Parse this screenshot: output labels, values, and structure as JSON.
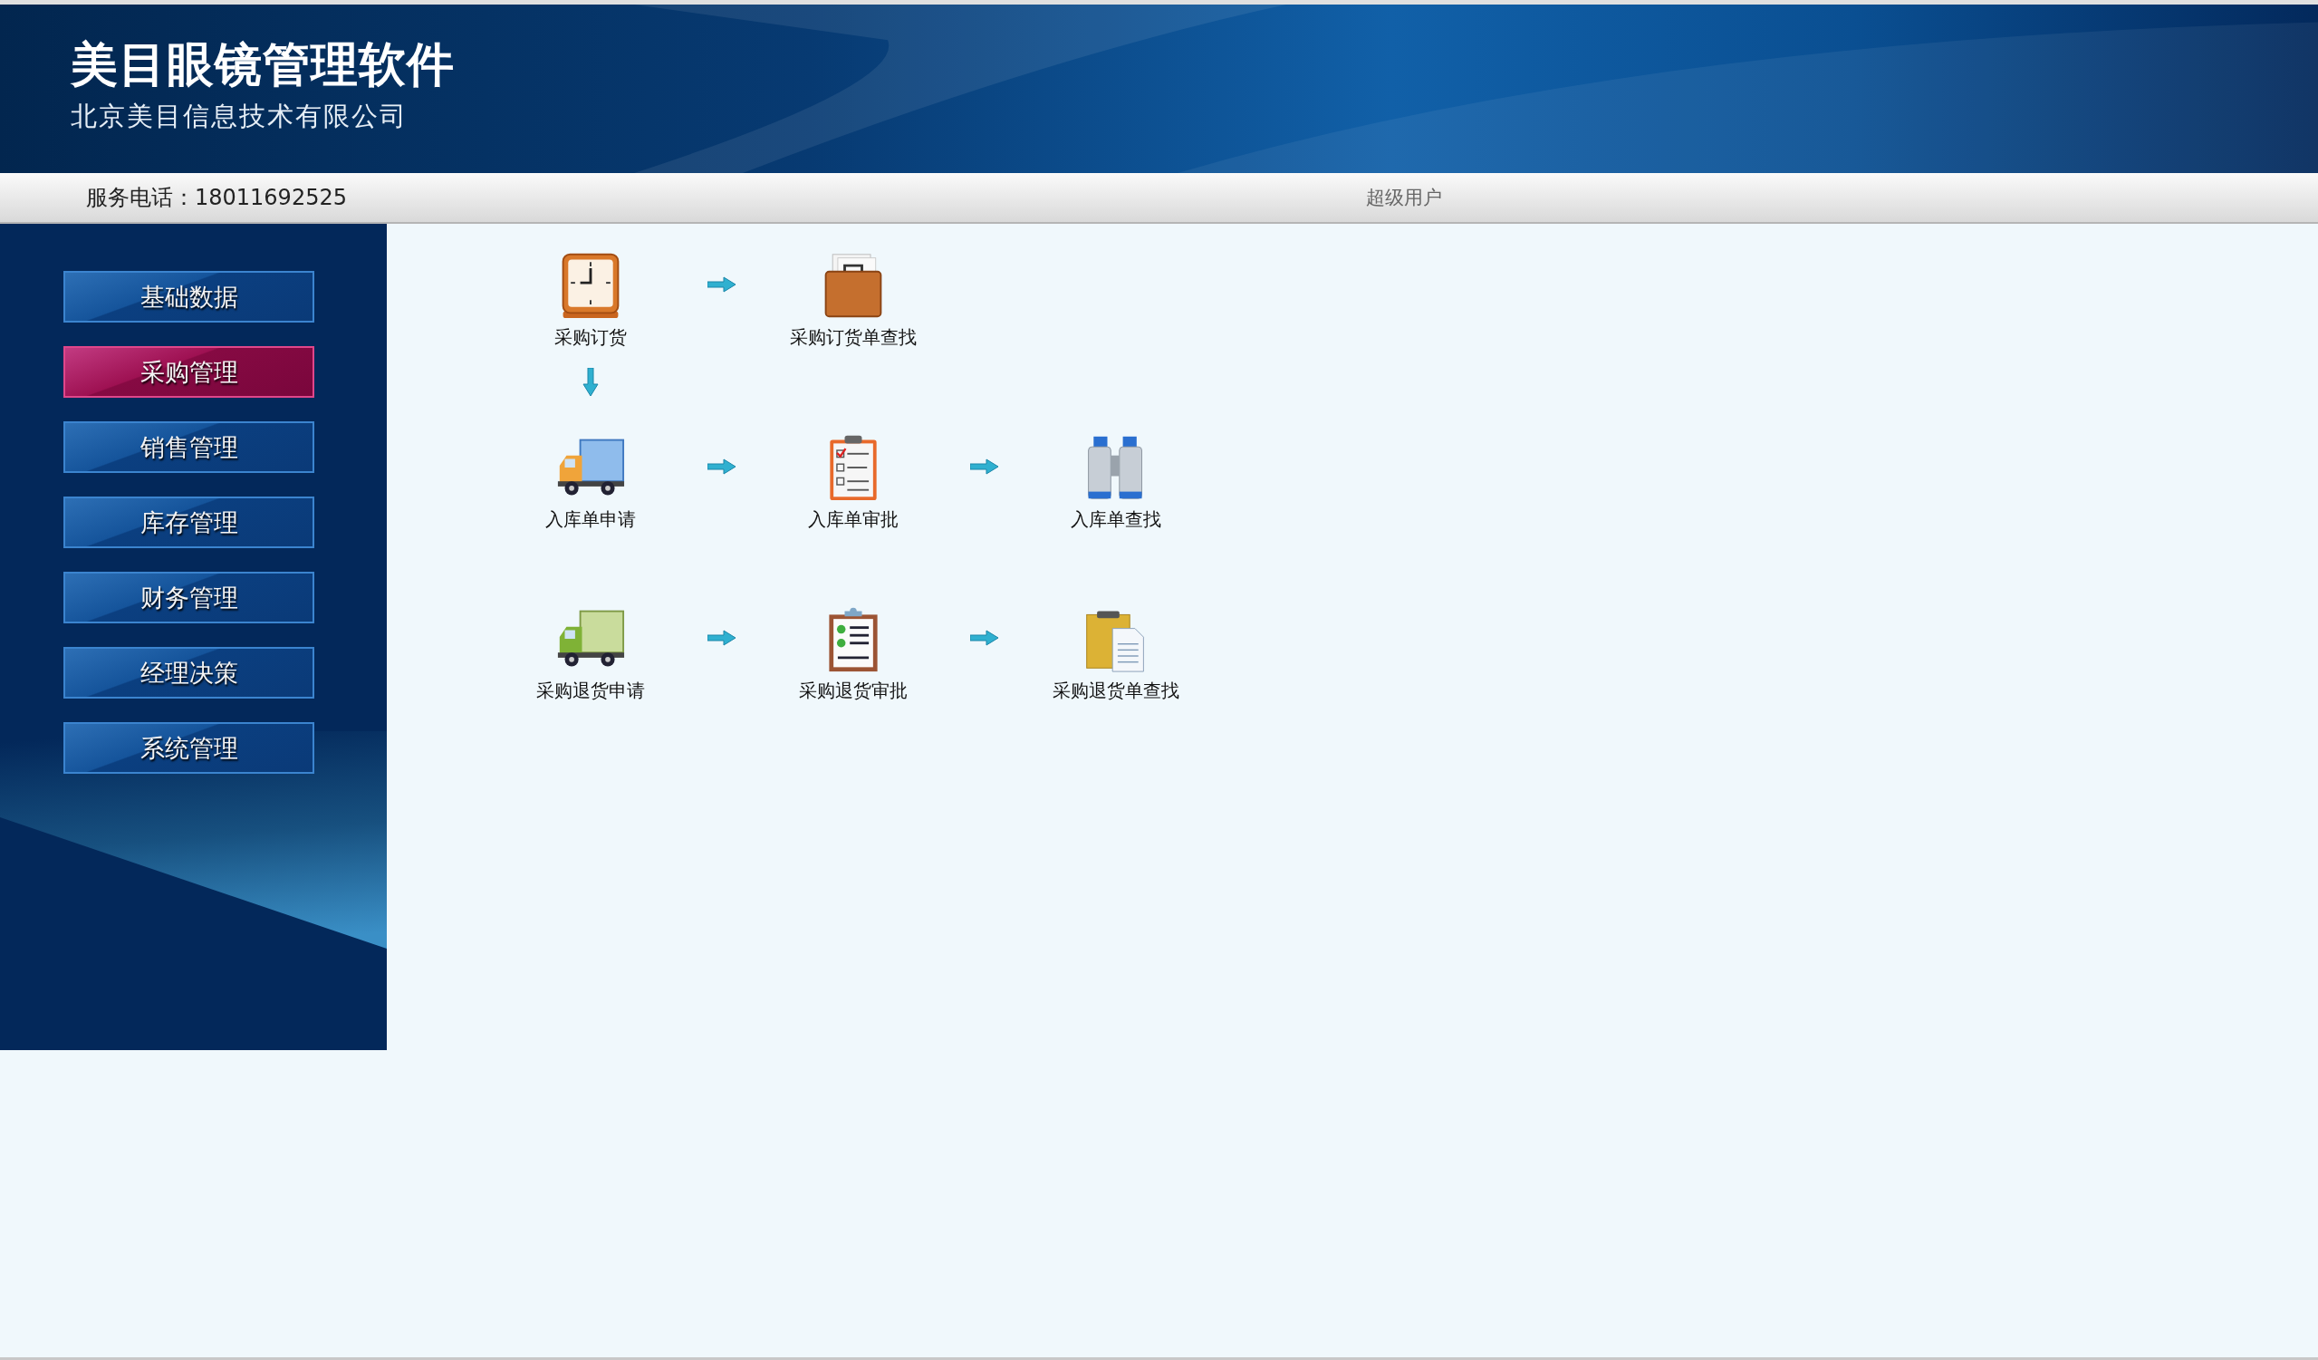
{
  "header": {
    "title": "美目眼镜管理软件",
    "subtitle": "北京美目信息技术有限公司"
  },
  "info_bar": {
    "service_phone": "服务电话：18011692525",
    "user_role": "超级用户"
  },
  "sidebar": {
    "items": [
      {
        "label": "基础数据",
        "selected": false
      },
      {
        "label": "采购管理",
        "selected": true
      },
      {
        "label": "销售管理",
        "selected": false
      },
      {
        "label": "库存管理",
        "selected": false
      },
      {
        "label": "财务管理",
        "selected": false
      },
      {
        "label": "经理决策",
        "selected": false
      },
      {
        "label": "系统管理",
        "selected": false
      }
    ]
  },
  "flow": {
    "rows": [
      {
        "arrow_below": true,
        "steps": [
          {
            "label": "采购订货",
            "kind": "clock"
          },
          {
            "label": "采购订货单查找",
            "kind": "briefcase"
          }
        ]
      },
      {
        "arrow_below": false,
        "steps": [
          {
            "label": "入库单申请",
            "kind": "blue-truck"
          },
          {
            "label": "入库单审批",
            "kind": "checklist"
          },
          {
            "label": "入库单查找",
            "kind": "binoculars"
          }
        ]
      },
      {
        "arrow_below": false,
        "steps": [
          {
            "label": "采购退货申请",
            "kind": "green-truck"
          },
          {
            "label": "采购退货审批",
            "kind": "approved-clipboard"
          },
          {
            "label": "采购退货单查找",
            "kind": "clipboard-document"
          }
        ]
      }
    ]
  }
}
